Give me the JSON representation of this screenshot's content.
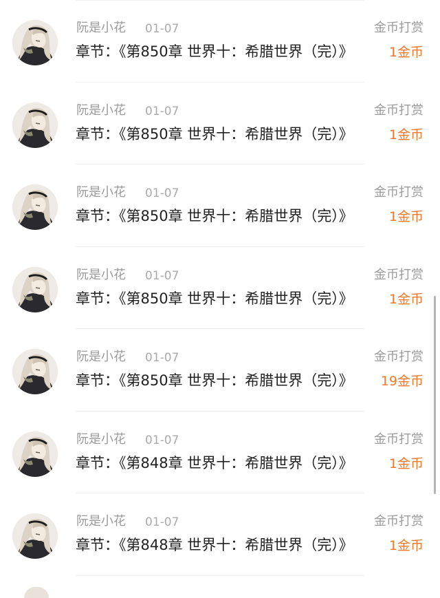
{
  "rewards": [
    {
      "name": "阮是小花",
      "date": "01-07",
      "type": "金币打赏",
      "chapter": "章节：《第850章 世界十：希腊世界（完）》",
      "amount": "1金币"
    },
    {
      "name": "阮是小花",
      "date": "01-07",
      "type": "金币打赏",
      "chapter": "章节：《第850章 世界十：希腊世界（完）》",
      "amount": "1金币"
    },
    {
      "name": "阮是小花",
      "date": "01-07",
      "type": "金币打赏",
      "chapter": "章节：《第850章 世界十：希腊世界（完）》",
      "amount": "1金币"
    },
    {
      "name": "阮是小花",
      "date": "01-07",
      "type": "金币打赏",
      "chapter": "章节：《第850章 世界十：希腊世界（完）》",
      "amount": "1金币"
    },
    {
      "name": "阮是小花",
      "date": "01-07",
      "type": "金币打赏",
      "chapter": "章节：《第850章 世界十：希腊世界（完）》",
      "amount": "19金币"
    },
    {
      "name": "阮是小花",
      "date": "01-07",
      "type": "金币打赏",
      "chapter": "章节：《第848章 世界十：希腊世界（完）》",
      "amount": "1金币"
    },
    {
      "name": "阮是小花",
      "date": "01-07",
      "type": "金币打赏",
      "chapter": "章节：《第848章 世界十：希腊世界（完）》",
      "amount": "1金币"
    }
  ],
  "colors": {
    "accent": "#f07a2a",
    "muted": "#9b9b9b",
    "text": "#222222"
  },
  "icons": {
    "avatar": "user-avatar-anime-girl"
  }
}
